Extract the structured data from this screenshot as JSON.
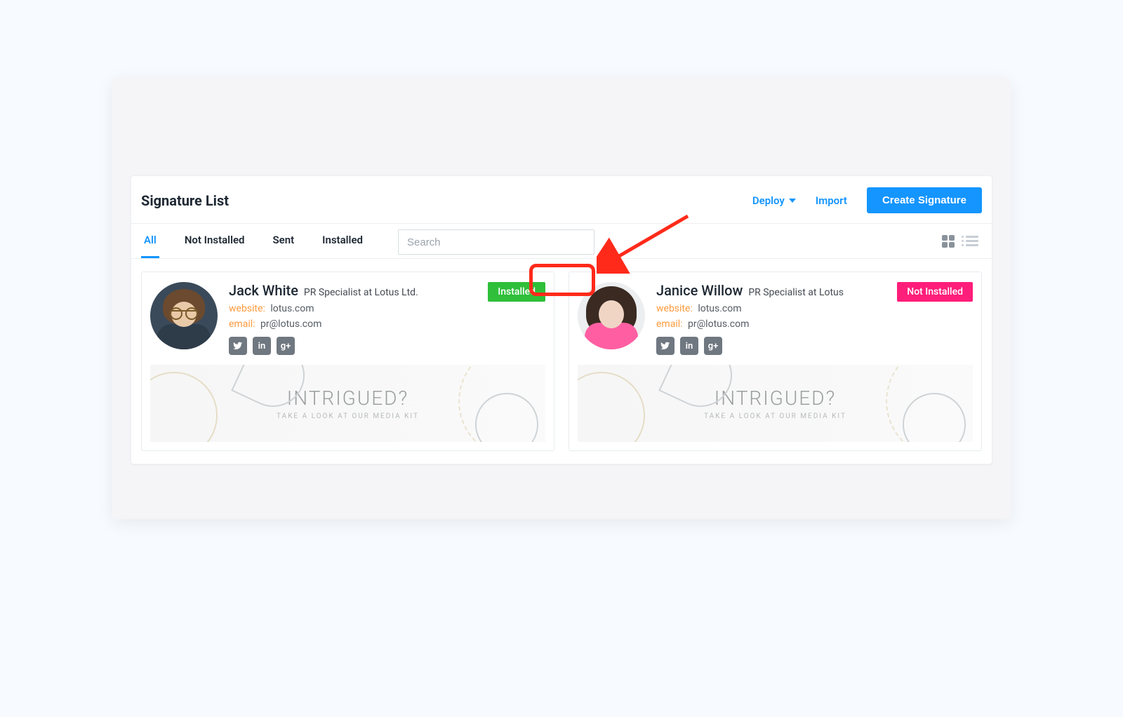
{
  "page": {
    "title": "Signature List"
  },
  "header_actions": {
    "deploy_label": "Deploy",
    "import_label": "Import",
    "create_label": "Create Signature"
  },
  "tabs": {
    "all": "All",
    "not_installed": "Not Installed",
    "sent": "Sent",
    "installed": "Installed",
    "active": "all"
  },
  "search": {
    "placeholder": "Search",
    "value": ""
  },
  "view_mode": "grid",
  "banner": {
    "headline": "INTRIGUED?",
    "subline": "TAKE A LOOK AT OUR MEDIA KIT"
  },
  "labels": {
    "website": "website:",
    "email": "email:"
  },
  "social_icons": [
    "twitter",
    "linkedin",
    "google"
  ],
  "cards": [
    {
      "name": "Jack White",
      "role": "PR Specialist at Lotus Ltd.",
      "website": "lotus.com",
      "email": "pr@lotus.com",
      "status": "Installed",
      "status_color": "green"
    },
    {
      "name": "Janice Willow",
      "role": "PR Specialist at Lotus",
      "website": "lotus.com",
      "email": "pr@lotus.com",
      "status": "Not Installed",
      "status_color": "pink"
    }
  ],
  "callout": {
    "target": "installed-badge"
  }
}
